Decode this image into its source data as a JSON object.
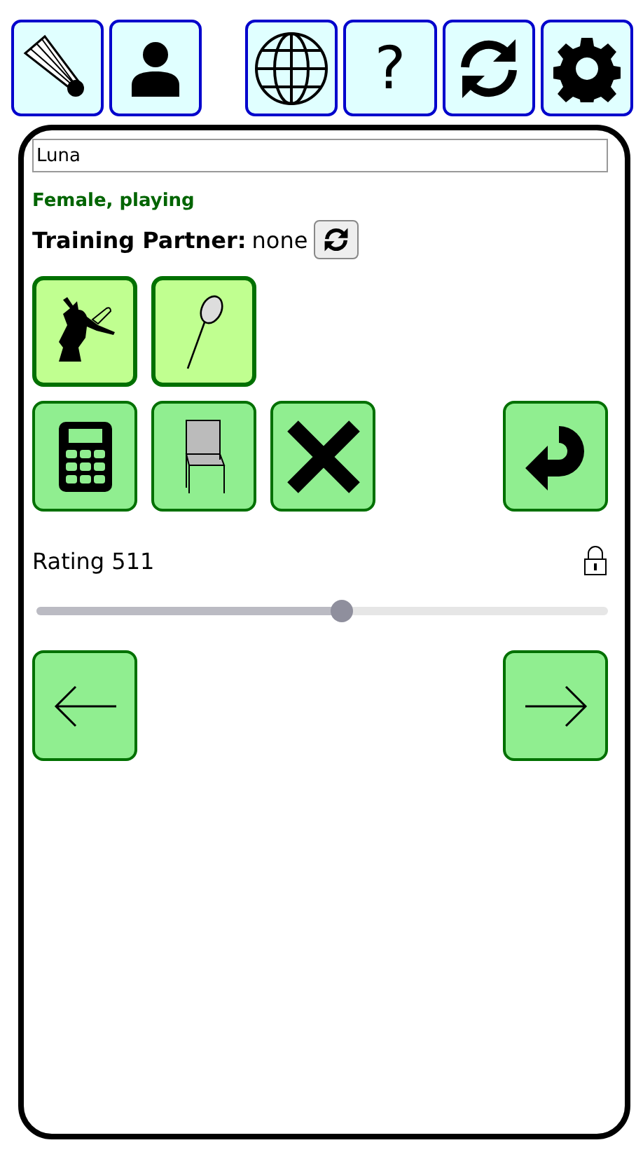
{
  "toolbar": {
    "help_label": "?"
  },
  "player": {
    "name": "Luna",
    "status": "Female, playing",
    "partner_label": "Training Partner:",
    "partner_value": "none"
  },
  "mode_buttons": [
    {
      "kind": "mode"
    },
    {
      "kind": "mode"
    }
  ],
  "action_buttons": [
    {
      "kind": "action"
    },
    {
      "kind": "action"
    },
    {
      "kind": "action"
    },
    {
      "kind": "spacer"
    },
    {
      "kind": "action"
    }
  ],
  "rating": {
    "label": "Rating 511",
    "locked": true,
    "level": 0.535
  }
}
